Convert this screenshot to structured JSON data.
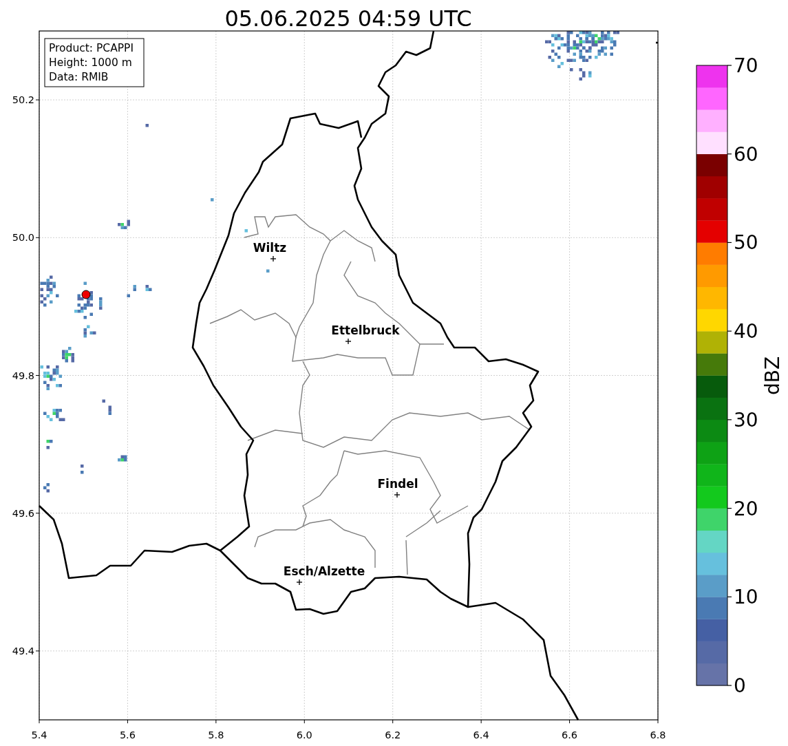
{
  "title": "05.06.2025 04:59 UTC",
  "info_box": [
    "Product: PCAPPI",
    "Height: 1000 m",
    "Data: RMIB"
  ],
  "map": {
    "xticks": [
      "5.4",
      "5.6",
      "5.8",
      "6.0",
      "6.2",
      "6.4",
      "6.6",
      "6.8"
    ],
    "yticks": [
      "50.2",
      "50.0",
      "49.8",
      "49.6",
      "49.4"
    ],
    "places": [
      {
        "name": "Wiltz"
      },
      {
        "name": "Ettelbruck"
      },
      {
        "name": "Findel"
      },
      {
        "name": "Esch/Alzette"
      }
    ]
  },
  "colorbar": {
    "label": "dBZ",
    "ticks": [
      "70",
      "60",
      "50",
      "40",
      "30",
      "20",
      "10",
      "0"
    ],
    "segments": [
      {
        "color": "#6673a8"
      },
      {
        "color": "#566aa6"
      },
      {
        "color": "#4560a4"
      },
      {
        "color": "#4a7ab3"
      },
      {
        "color": "#5a9dc8"
      },
      {
        "color": "#66c0dd"
      },
      {
        "color": "#64d6c4"
      },
      {
        "color": "#3fd46a"
      },
      {
        "color": "#13c91d"
      },
      {
        "color": "#10b51a"
      },
      {
        "color": "#0ea215"
      },
      {
        "color": "#0c8a13"
      },
      {
        "color": "#0a7211"
      },
      {
        "color": "#075b0c"
      },
      {
        "color": "#467a0a"
      },
      {
        "color": "#b0b205"
      },
      {
        "color": "#ffd700"
      },
      {
        "color": "#ffb700"
      },
      {
        "color": "#ff9a00"
      },
      {
        "color": "#ff7c00"
      },
      {
        "color": "#e40000"
      },
      {
        "color": "#c00000"
      },
      {
        "color": "#a00000"
      },
      {
        "color": "#7a0000"
      },
      {
        "color": "#ffe0ff"
      },
      {
        "color": "#ffb0ff"
      },
      {
        "color": "#ff66ff"
      },
      {
        "color": "#ee33ee"
      }
    ]
  }
}
